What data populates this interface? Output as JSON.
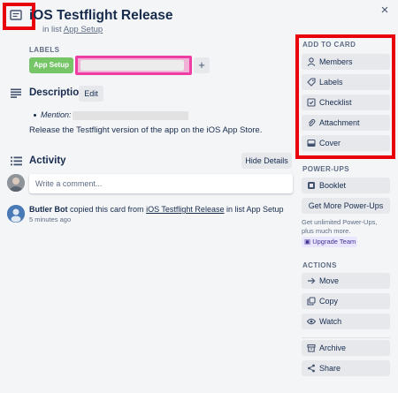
{
  "card": {
    "title": "iOS Testflight Release",
    "in_list_prefix": "in list",
    "list_name": "App Setup",
    "close_glyph": "×"
  },
  "labels_section": {
    "heading": "LABELS",
    "chips": [
      {
        "text": "App Setup",
        "color": "#61bd4f"
      }
    ],
    "add_glyph": "+"
  },
  "description": {
    "heading": "Description",
    "edit_label": "Edit",
    "mention_label": "Mention:",
    "text": "Release the Testflight version of the app on the iOS App Store."
  },
  "activity": {
    "heading": "Activity",
    "hide_label": "Hide Details",
    "comment_placeholder": "Write a comment...",
    "entry": {
      "user": "Butler Bot",
      "action": "copied this card from",
      "card_link": "iOS Testflight Release",
      "middle": "in list",
      "list": "App Setup",
      "time": "5 minutes ago"
    }
  },
  "sidebar": {
    "add_to_card_heading": "ADD TO CARD",
    "add_to_card": [
      {
        "label": "Members",
        "icon": "person-icon"
      },
      {
        "label": "Labels",
        "icon": "tag-icon"
      },
      {
        "label": "Checklist",
        "icon": "checklist-icon"
      },
      {
        "label": "Attachment",
        "icon": "paperclip-icon"
      },
      {
        "label": "Cover",
        "icon": "cover-icon"
      }
    ],
    "powerups_heading": "POWER-UPS",
    "booklet_label": "Booklet",
    "get_more_label": "Get More Power-Ups",
    "powerups_note": "Get unlimited Power-Ups, plus much more.",
    "upgrade_label": "Upgrade Team",
    "actions_heading": "ACTIONS",
    "actions": [
      {
        "label": "Move",
        "icon": "arrow-right-icon"
      },
      {
        "label": "Copy",
        "icon": "copy-icon"
      },
      {
        "label": "Watch",
        "icon": "eye-icon"
      },
      {
        "label": "Archive",
        "icon": "archive-icon"
      },
      {
        "label": "Share",
        "icon": "share-icon"
      }
    ]
  },
  "colors": {
    "highlight_red": "#e8000b",
    "highlight_pink": "#ef3ea3",
    "label_green": "#61bd4f",
    "button_gray": "#e6e8ec",
    "background": "#f4f5f7"
  }
}
